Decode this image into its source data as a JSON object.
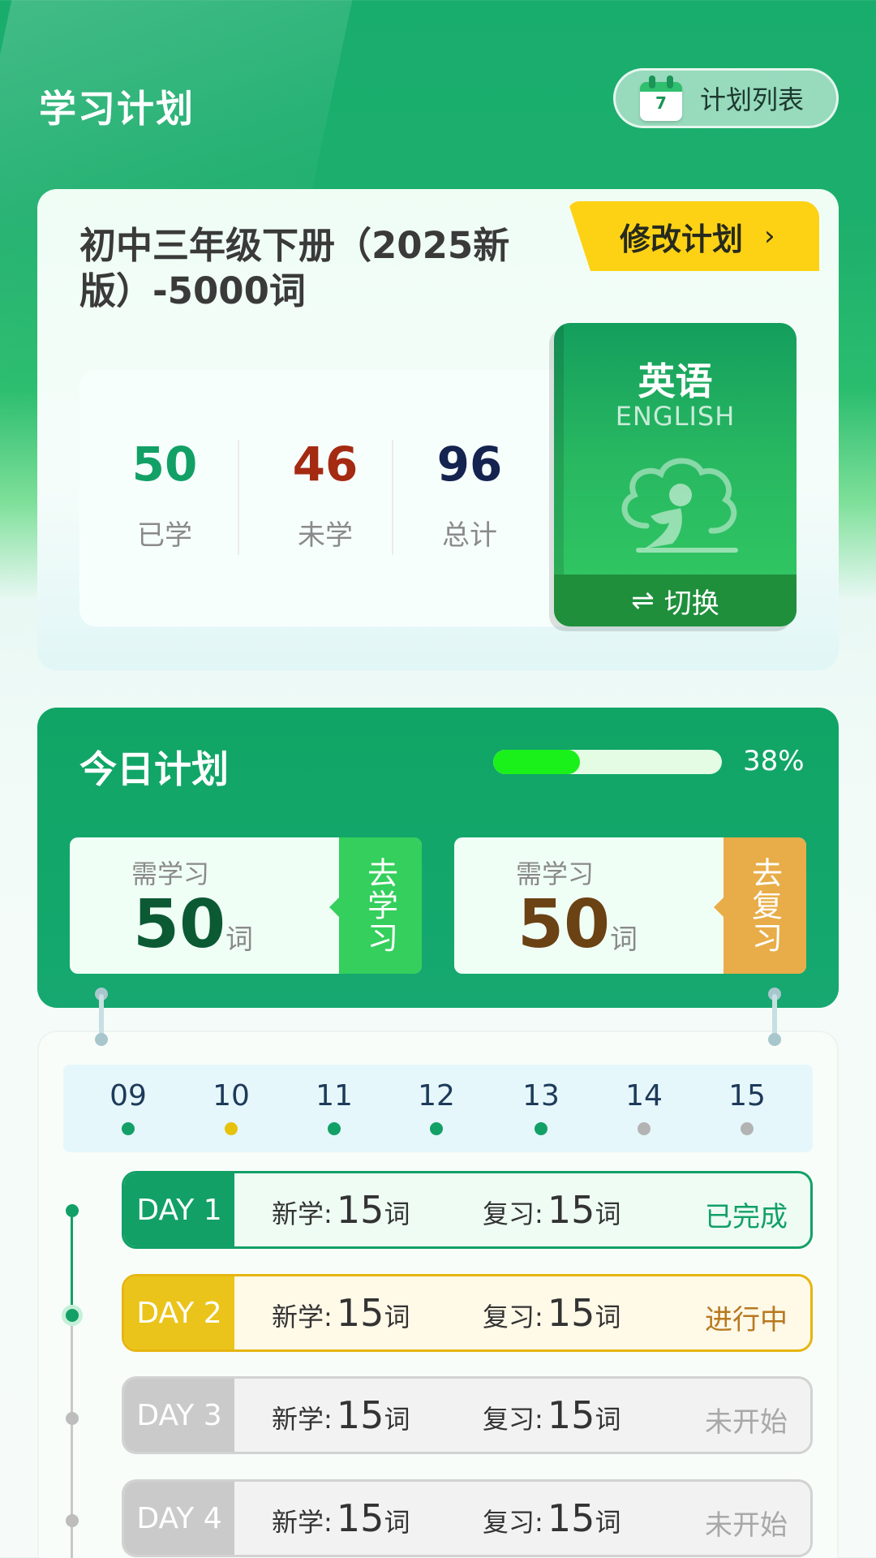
{
  "header": {
    "title": "学习计划",
    "plan_list": {
      "label": "计划列表",
      "icon": "calendar-icon",
      "icon_number": "7"
    }
  },
  "book": {
    "title": "初中三年级下册（2025新版）-5000词",
    "edit_label": "修改计划",
    "stats": [
      {
        "value": "50",
        "label": "已学",
        "color": "#12a066"
      },
      {
        "value": "46",
        "label": "未学",
        "color": "#a52a12"
      },
      {
        "value": "96",
        "label": "总计",
        "color": "#14234f"
      }
    ],
    "subject": {
      "name": "英语",
      "name_en": "ENGLISH",
      "switch_label": "切换"
    }
  },
  "today": {
    "title": "今日计划",
    "progress_percent": 38,
    "progress_label": "38%",
    "learn": {
      "need_label": "需学习",
      "count": "50",
      "unit": "词",
      "button": "去学习",
      "count_color": "#0b5a34"
    },
    "review": {
      "need_label": "需学习",
      "count": "50",
      "unit": "词",
      "button": "去复习",
      "count_color": "#6b4214"
    }
  },
  "dates": [
    {
      "day": "09",
      "status": "done"
    },
    {
      "day": "10",
      "status": "current"
    },
    {
      "day": "11",
      "status": "done"
    },
    {
      "day": "12",
      "status": "done"
    },
    {
      "day": "13",
      "status": "done"
    },
    {
      "day": "14",
      "status": "pending"
    },
    {
      "day": "15",
      "status": "pending"
    }
  ],
  "days": [
    {
      "tag": "DAY 1",
      "new_label": "新学:",
      "new_count": "15",
      "review_label": "复习:",
      "review_count": "15",
      "unit": "词",
      "status": "已完成",
      "state": "done"
    },
    {
      "tag": "DAY 2",
      "new_label": "新学:",
      "new_count": "15",
      "review_label": "复习:",
      "review_count": "15",
      "unit": "词",
      "status": "进行中",
      "state": "current"
    },
    {
      "tag": "DAY 3",
      "new_label": "新学:",
      "new_count": "15",
      "review_label": "复习:",
      "review_count": "15",
      "unit": "词",
      "status": "未开始",
      "state": "pending"
    },
    {
      "tag": "DAY 4",
      "new_label": "新学:",
      "new_count": "15",
      "review_label": "复习:",
      "review_count": "15",
      "unit": "词",
      "status": "未开始",
      "state": "pending"
    }
  ],
  "colors": {
    "brand_green": "#12a066",
    "done": "#12a066",
    "current": "#e6c20c",
    "pending": "#c8c8c8"
  }
}
